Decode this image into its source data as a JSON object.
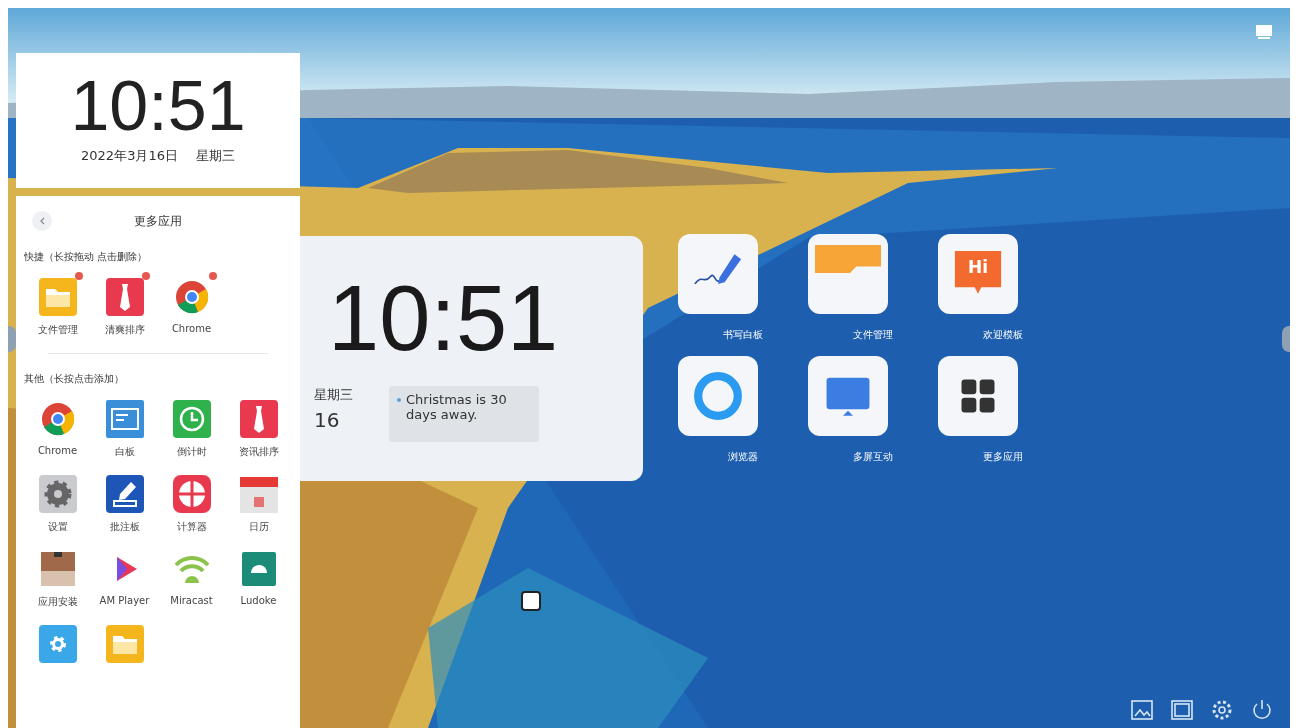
{
  "clock_card": {
    "time": "10:51",
    "date": "2022年3月16日",
    "weekday": "星期三"
  },
  "apps_panel": {
    "title": "更多应用",
    "sections": [
      {
        "label": "快捷（长按拖动 点击删除）",
        "apps": [
          {
            "name": "文件管理",
            "kind": "folder",
            "removable": true
          },
          {
            "name": "清爽排序",
            "kind": "tie",
            "removable": true
          },
          {
            "name": "Chrome",
            "kind": "chrome",
            "removable": true
          }
        ]
      },
      {
        "label": "其他（长按点击添加）",
        "apps": [
          {
            "name": "Chrome",
            "kind": "chrome",
            "removable": false
          },
          {
            "name": "白板",
            "kind": "note",
            "removable": false
          },
          {
            "name": "倒计时",
            "kind": "timer",
            "removable": false
          },
          {
            "name": "资讯排序",
            "kind": "tie",
            "removable": false
          },
          {
            "name": "设置",
            "kind": "gear",
            "removable": false
          },
          {
            "name": "批注板",
            "kind": "pen",
            "removable": false
          },
          {
            "name": "计算器",
            "kind": "calc",
            "removable": false
          },
          {
            "name": "日历",
            "kind": "calendar",
            "removable": false
          },
          {
            "name": "应用安装",
            "kind": "box",
            "removable": false
          },
          {
            "name": "AM Player",
            "kind": "play",
            "removable": false
          },
          {
            "name": "Miracast",
            "kind": "wifi",
            "removable": false
          },
          {
            "name": "Ludoke",
            "kind": "android",
            "removable": false
          },
          {
            "kind": "gearblue"
          },
          {
            "kind": "folder"
          }
        ]
      }
    ]
  },
  "widget": {
    "time": "10:51",
    "weekday": "星期三",
    "day": "16",
    "event": "Christmas is 30 days away."
  },
  "desktop_apps": [
    {
      "label": "书写白板",
      "kind": "pen"
    },
    {
      "label": "文件管理",
      "kind": "folder"
    },
    {
      "label": "欢迎模板",
      "kind": "hi",
      "text": "Hi"
    },
    {
      "label": "浏览器",
      "kind": "ring"
    },
    {
      "label": "多屏互动",
      "kind": "screen"
    },
    {
      "label": "更多应用",
      "kind": "grid"
    }
  ]
}
